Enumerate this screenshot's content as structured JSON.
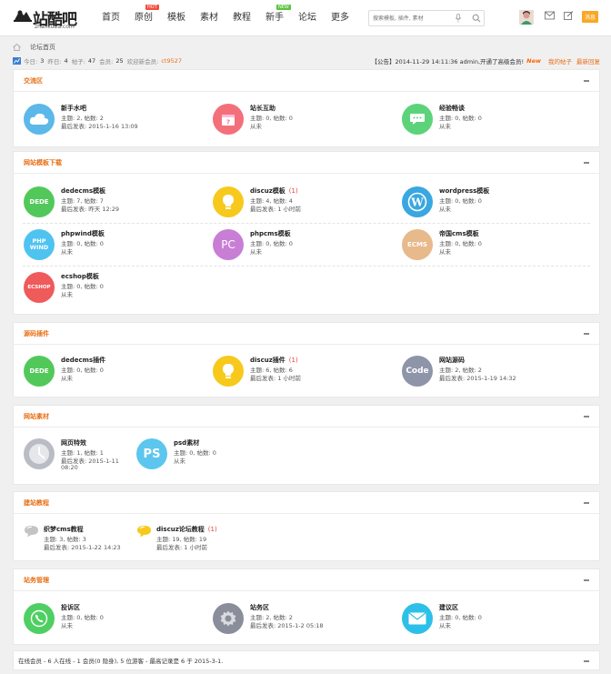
{
  "logo": {
    "text": "站酷吧",
    "sub": "zhankuba.com"
  },
  "nav": [
    {
      "label": "首页",
      "badge": ""
    },
    {
      "label": "原创",
      "badge": "HOT"
    },
    {
      "label": "模板",
      "badge": ""
    },
    {
      "label": "素材",
      "badge": ""
    },
    {
      "label": "教程",
      "badge": ""
    },
    {
      "label": "新手",
      "badge": "NEW"
    },
    {
      "label": "论坛",
      "badge": ""
    },
    {
      "label": "更多",
      "badge": ""
    }
  ],
  "search": {
    "placeholder": "搜索模板, 插件, 素材"
  },
  "header_right": {
    "message_button": "消息"
  },
  "breadcrumb": {
    "current": "论坛首页"
  },
  "stats": {
    "today_label": "今日:",
    "today": "3",
    "yesterday_label": "昨日:",
    "yesterday": "4",
    "posts_label": "帖子:",
    "posts": "47",
    "members_label": "会员:",
    "members": "25",
    "newest_label": "欢迎新会员:",
    "newest": "ct9527",
    "notice": "【公告】2014-11-29 14:11:36 admin,开通了高级会员!",
    "new_tag": "New",
    "my_posts": "我的帖子",
    "latest_replies": "最新回复"
  },
  "sections": [
    {
      "title": "交流区",
      "forums": [
        {
          "name": "新手水吧",
          "today": "",
          "line1": "主题: 2, 帖数: 2",
          "line2": "最后发表: 2015-1-16 13:09",
          "icon": "cloud-icon",
          "color": "#5cb8e8"
        },
        {
          "name": "站长互助",
          "today": "",
          "line1": "主题: 0, 帖数: 0",
          "line2": "从未",
          "icon": "calendar-icon",
          "color": "#f3707a"
        },
        {
          "name": "经验畅谈",
          "today": "",
          "line1": "主题: 0, 帖数: 0",
          "line2": "从未",
          "icon": "chat-icon",
          "color": "#5cd37a"
        }
      ]
    },
    {
      "title": "网站模板下载",
      "forums": [
        {
          "name": "dedecms模板",
          "today": "",
          "line1": "主题: 7, 帖数: 7",
          "line2": "最后发表: 昨天 12:29",
          "icon": "dedecms-icon",
          "color": "#52c85a",
          "label": "DEDE"
        },
        {
          "name": "discuz模板",
          "today": "(1)",
          "line1": "主题: 4, 帖数: 4",
          "line2": "最后发表: 1 小时前",
          "icon": "discuz-icon",
          "color": "#f6c91c"
        },
        {
          "name": "wordpress模板",
          "today": "",
          "line1": "主题: 0, 帖数: 0",
          "line2": "从未",
          "icon": "wordpress-icon",
          "color": "#3aa7e0"
        },
        {
          "name": "phpwind模板",
          "today": "",
          "line1": "主题: 0, 帖数: 0",
          "line2": "从未",
          "icon": "phpwind-icon",
          "color": "#4fc3f0",
          "label": "PHP WIND"
        },
        {
          "name": "phpcms模板",
          "today": "",
          "line1": "主题: 0, 帖数: 0",
          "line2": "从未",
          "icon": "phpcms-icon",
          "color": "#c97ed6",
          "label": "PC"
        },
        {
          "name": "帝国cms模板",
          "today": "",
          "line1": "主题: 0, 帖数: 0",
          "line2": "从未",
          "icon": "empirecms-icon",
          "color": "#e8b98a",
          "label": "ECMS"
        },
        {
          "name": "ecshop模板",
          "today": "",
          "line1": "主题: 0, 帖数: 0",
          "line2": "从未",
          "icon": "ecshop-icon",
          "color": "#ef5a5a",
          "label": "ECSHOP"
        }
      ]
    },
    {
      "title": "源码插件",
      "forums": [
        {
          "name": "dedecms插件",
          "today": "",
          "line1": "主题: 0, 帖数: 0",
          "line2": "从未",
          "icon": "dedecms-icon",
          "color": "#52c85a",
          "label": "DEDE"
        },
        {
          "name": "discuz插件",
          "today": "(1)",
          "line1": "主题: 6, 帖数: 6",
          "line2": "最后发表: 1 小时前",
          "icon": "discuz-icon",
          "color": "#f6c91c"
        },
        {
          "name": "网站源码",
          "today": "",
          "line1": "主题: 2, 帖数: 2",
          "line2": "最后发表: 2015-1-19 14:32",
          "icon": "code-icon",
          "color": "#8e95a8",
          "label": "Code"
        }
      ]
    },
    {
      "title": "网站素材",
      "forums": [
        {
          "name": "网页特效",
          "today": "",
          "line1": "主题: 1, 帖数: 1",
          "line2": "最后发表: 2015-1-11",
          "line3": "08:20",
          "icon": "clock-icon",
          "color": "#b9bcc4"
        },
        {
          "name": "psd素材",
          "today": "",
          "line1": "主题: 0, 帖数: 0",
          "line2": "从未",
          "icon": "ps-icon",
          "color": "#5cc6ee",
          "label": "PS"
        }
      ]
    },
    {
      "title": "建站教程",
      "forums": [
        {
          "name": "织梦cms教程",
          "today": "",
          "line1": "主题: 3, 帖数: 3",
          "line2": "最后发表: 2015-1-22 14:23",
          "icon": "bubble-grey-icon",
          "color": "#bfbfbf"
        },
        {
          "name": "discuz论坛教程",
          "today": "(1)",
          "line1": "主题: 19, 帖数: 19",
          "line2": "最后发表: 1 小时前",
          "icon": "bubble-yellow-icon",
          "color": "#f6c91c"
        }
      ]
    },
    {
      "title": "站务管理",
      "forums": [
        {
          "name": "投诉区",
          "today": "",
          "line1": "主题: 0, 帖数: 0",
          "line2": "从未",
          "icon": "phone-icon",
          "color": "#4fcf62"
        },
        {
          "name": "站务区",
          "today": "",
          "line1": "主题: 2, 帖数: 2",
          "line2": "最后发表: 2015-1-2 05:18",
          "icon": "settings-icon",
          "color": "#8a8d9a"
        },
        {
          "name": "建议区",
          "today": "",
          "line1": "主题: 0, 帖数: 0",
          "line2": "从未",
          "icon": "mail-icon",
          "color": "#2cc0e8"
        }
      ]
    }
  ],
  "online": "在线会员 - 6 人在线 - 1 会员(0 隐身), 5 位游客 - 最高记录是 6 于 2015-3-1."
}
